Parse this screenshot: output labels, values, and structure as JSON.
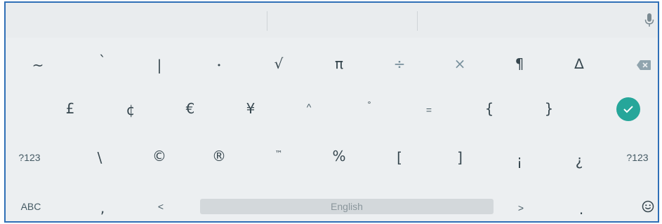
{
  "colors": {
    "frame_border": "#2f6fb6",
    "keyboard_bg": "#eceff1",
    "key_text": "#37474f",
    "enter_bg": "#26a69a",
    "spacebar_bg": "#d3d8db"
  },
  "suggestion_bar": {
    "mic_icon": "microphone-icon"
  },
  "row1": [
    "~",
    "`",
    "|",
    "•",
    "√",
    "π",
    "÷",
    "×",
    "¶",
    "∆"
  ],
  "row2": [
    "£",
    "¢",
    "€",
    "¥",
    "^",
    "°",
    "=",
    "{",
    "}"
  ],
  "row3": [
    "?123",
    "\\",
    "©",
    "®",
    "™",
    "%",
    "[",
    "]",
    "¡",
    "¿",
    "?123"
  ],
  "row4": {
    "abc": "ABC",
    "comma": ",",
    "less_than": "<",
    "space_label": "English",
    "greater_than": ">",
    "period": "."
  },
  "icons": {
    "backspace": "backspace-icon",
    "enter": "enter-check-icon",
    "emoji": "emoji-icon"
  }
}
